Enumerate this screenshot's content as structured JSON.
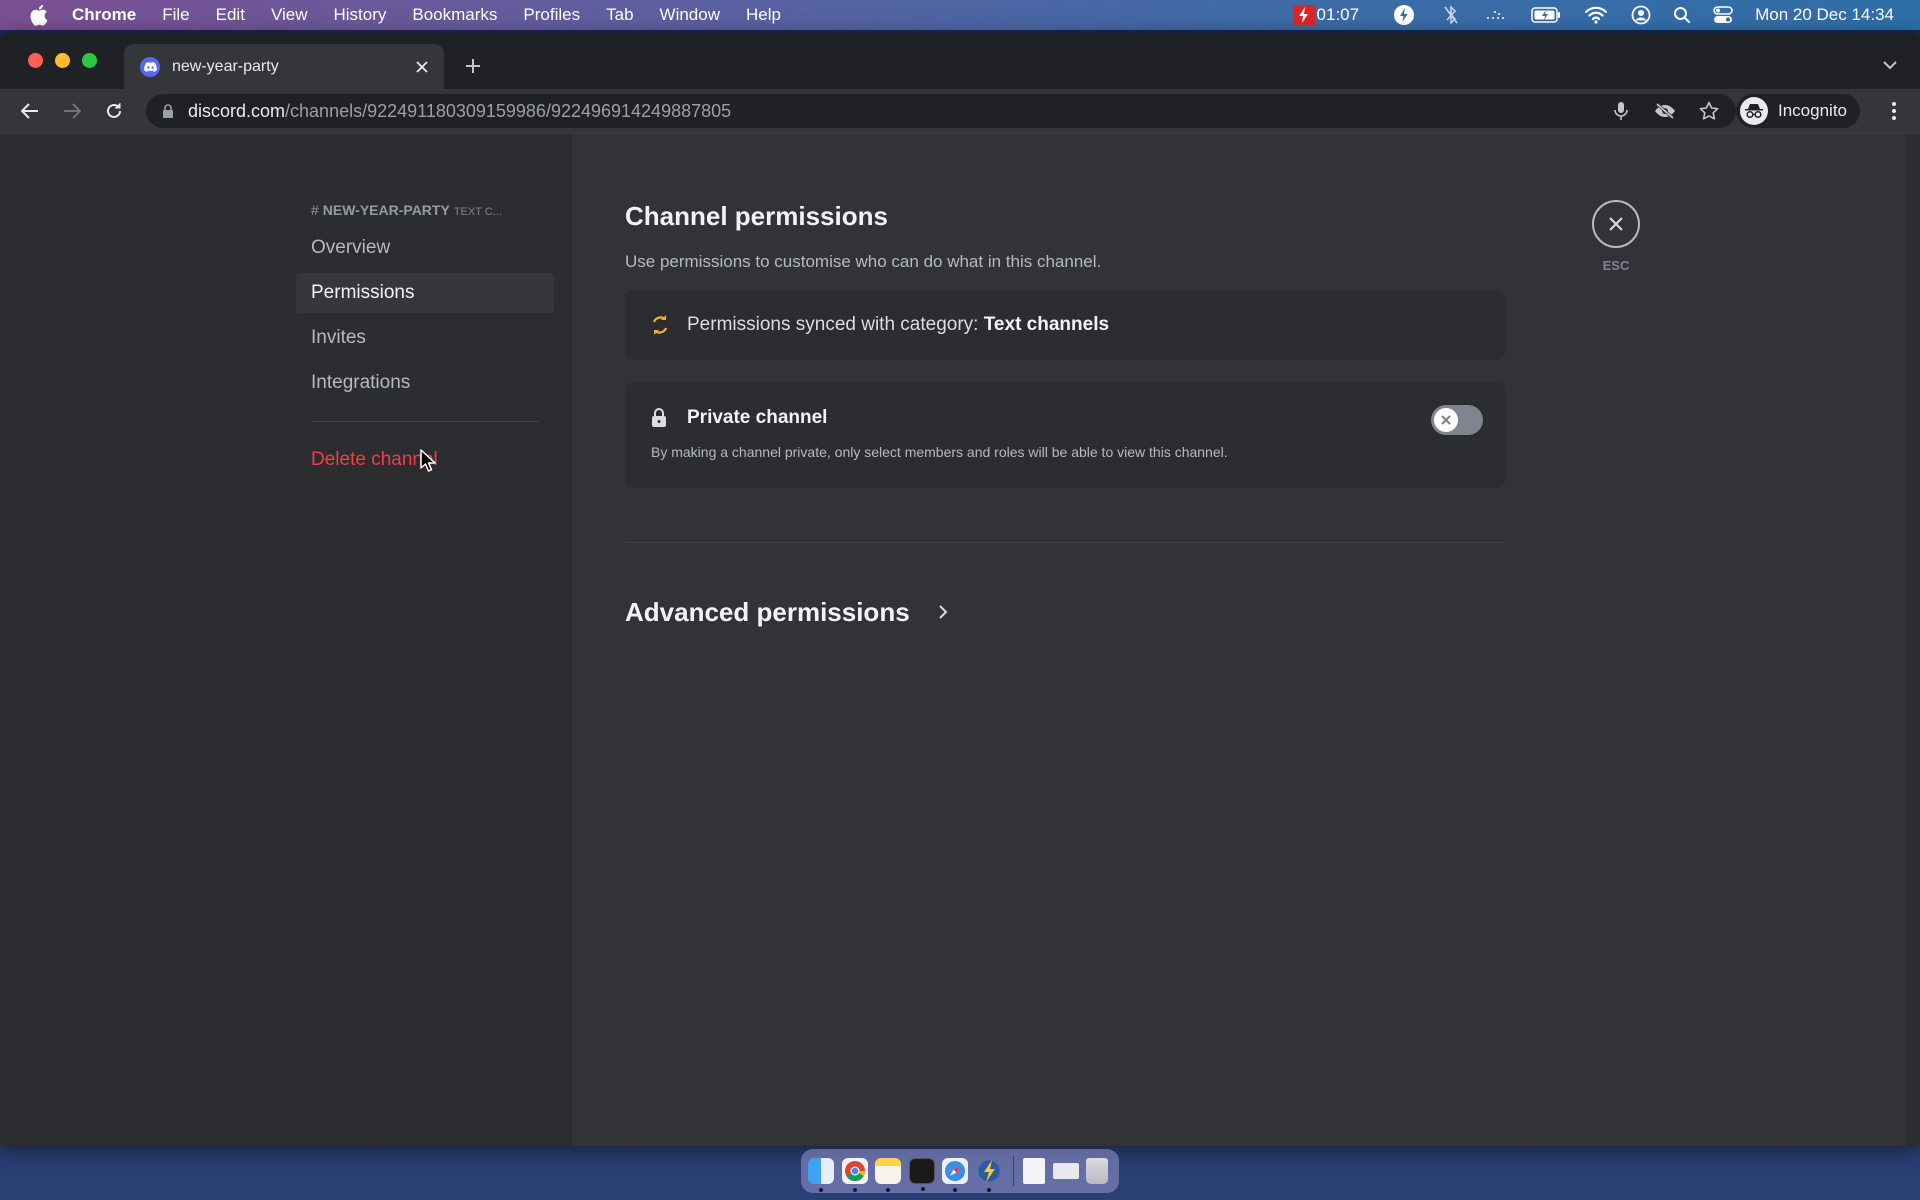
{
  "menubar": {
    "app_name": "Chrome",
    "items": [
      "File",
      "Edit",
      "View",
      "History",
      "Bookmarks",
      "Profiles",
      "Tab",
      "Window",
      "Help"
    ],
    "recording_time": "01:07",
    "clock": "Mon 20 Dec  14:34",
    "status_icons": [
      "bolt-icon",
      "bluetooth-off-icon",
      "dots-icon",
      "battery-charging-icon",
      "wifi-icon",
      "user-circle-icon",
      "search-icon",
      "control-center-icon"
    ]
  },
  "browser": {
    "tab_title": "new-year-party",
    "url_host": "discord.com",
    "url_path": "/channels/922491180309159986/922496914249887805",
    "profile_label": "Incognito"
  },
  "sidebar": {
    "channel_name": "NEW-YEAR-PARTY",
    "channel_sub": "TEXT C...",
    "items": [
      {
        "label": "Overview",
        "active": false
      },
      {
        "label": "Permissions",
        "active": true
      },
      {
        "label": "Invites",
        "active": false
      },
      {
        "label": "Integrations",
        "active": false
      }
    ],
    "delete_label": "Delete channel"
  },
  "main": {
    "title": "Channel permissions",
    "description": "Use permissions to customise who can do what in this channel.",
    "sync_text": "Permissions synced with category: ",
    "sync_category": "Text channels",
    "private_label": "Private channel",
    "private_desc": "By making a channel private, only select members and roles will be able to view this channel.",
    "private_enabled": false,
    "advanced_label": "Advanced permissions",
    "close_label": "ESC"
  },
  "colors": {
    "accent": "#5865f2",
    "danger": "#f23f43",
    "sync": "#f0b232"
  },
  "dock": {
    "apps": [
      "Finder",
      "Chrome",
      "Notes",
      "Terminal",
      "Safari",
      "Lightning App"
    ],
    "others": [
      "Document",
      "Preview Window",
      "Trash"
    ]
  }
}
